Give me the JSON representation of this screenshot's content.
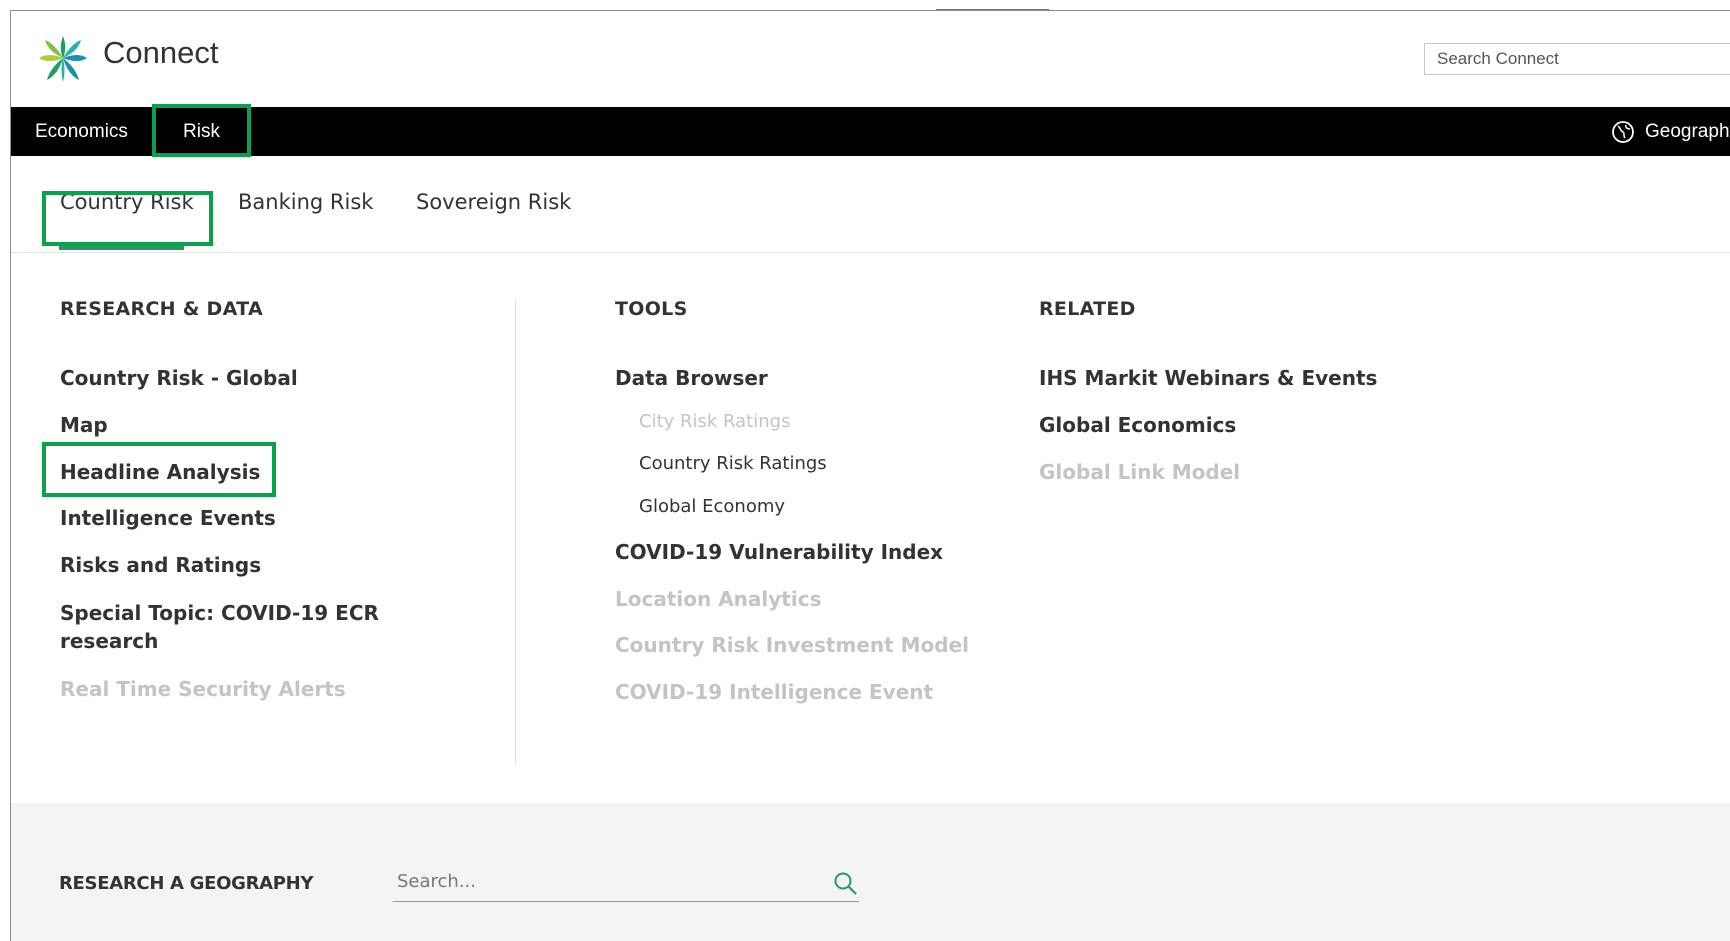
{
  "header": {
    "app_title": "Connect",
    "search_placeholder": "Search Connect"
  },
  "navbar": {
    "items": [
      {
        "label": "Economics"
      },
      {
        "label": "Risk"
      }
    ],
    "geography_label": "Geography"
  },
  "subtabs": [
    {
      "label": "Country Risk",
      "active": true
    },
    {
      "label": "Banking Risk"
    },
    {
      "label": "Sovereign Risk"
    }
  ],
  "research": {
    "heading": "RESEARCH & DATA",
    "links": [
      {
        "label": "Country Risk - Global"
      },
      {
        "label": "Map"
      },
      {
        "label": "Headline Analysis"
      },
      {
        "label": "Intelligence Events"
      },
      {
        "label": "Risks and Ratings"
      },
      {
        "label": "Special Topic: COVID-19 ECR research"
      },
      {
        "label": "Real Time Security Alerts",
        "disabled": true
      }
    ]
  },
  "tools": {
    "heading": "TOOLS",
    "links": [
      {
        "label": "Data Browser"
      },
      {
        "label": "City Risk Ratings",
        "disabled": true
      },
      {
        "label": "Country Risk Ratings"
      },
      {
        "label": "Global Economy"
      },
      {
        "label": "COVID-19 Vulnerability Index"
      },
      {
        "label": "Location Analytics",
        "disabled": true
      },
      {
        "label": "Country Risk Investment Model",
        "disabled": true
      },
      {
        "label": "COVID-19 Intelligence Event",
        "disabled": true
      }
    ]
  },
  "related": {
    "heading": "RELATED",
    "links": [
      {
        "label": "IHS Markit Webinars & Events"
      },
      {
        "label": "Global Economics"
      },
      {
        "label": "Global Link Model",
        "disabled": true
      }
    ]
  },
  "footer": {
    "label": "RESEARCH A GEOGRAPHY",
    "search_placeholder": "Search..."
  },
  "colors": {
    "accent": "#1f9d62",
    "highlight": "#0aa14a",
    "navbar": "#000000",
    "disabled_text": "#c4c4c4"
  },
  "icons": [
    "logo-icon",
    "globe-icon",
    "search-icon"
  ]
}
